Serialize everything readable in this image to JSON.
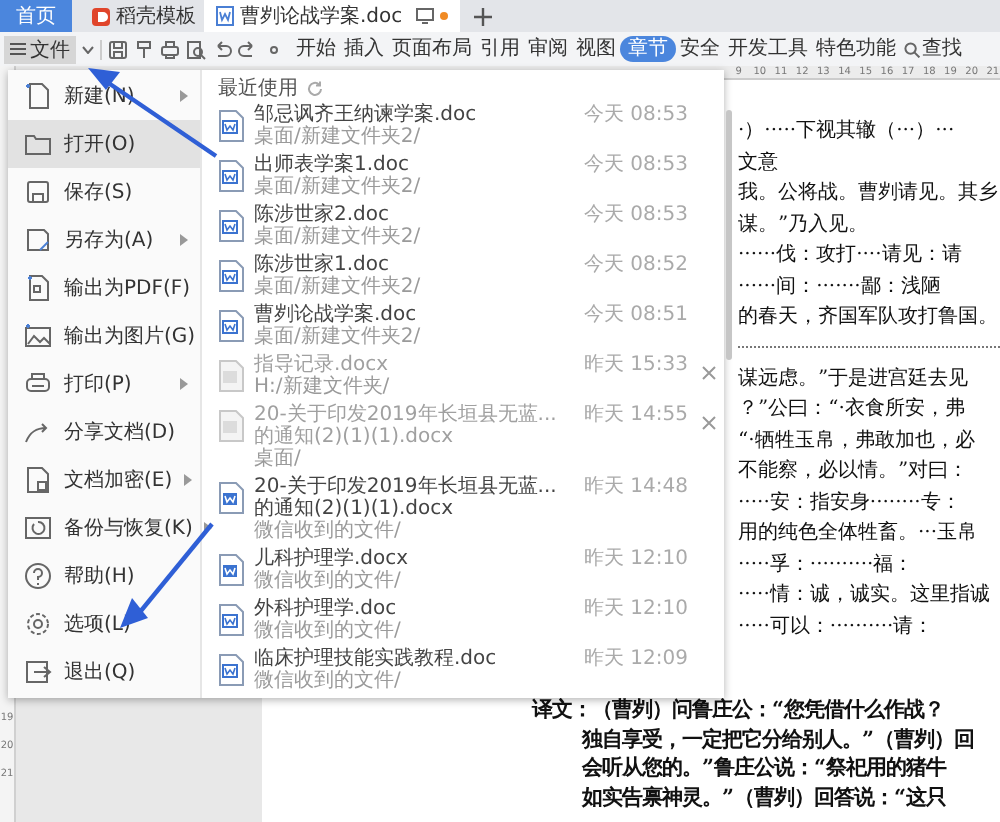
{
  "title_tabs": [
    {
      "kind": "home",
      "label": "首页",
      "selected": false
    },
    {
      "kind": "template",
      "label": "稻壳模板",
      "selected": false
    },
    {
      "kind": "document",
      "label": "曹刿论战学案.doc",
      "selected": true,
      "modified": true
    }
  ],
  "toolbar": {
    "file_menu": {
      "label": "文件",
      "expanded": true
    },
    "ribbon_tabs": [
      {
        "label": "开始",
        "selected": false
      },
      {
        "label": "插入",
        "selected": false
      },
      {
        "label": "页面布局",
        "selected": false
      },
      {
        "label": "引用",
        "selected": false
      },
      {
        "label": "审阅",
        "selected": false
      },
      {
        "label": "视图",
        "selected": false
      },
      {
        "label": "章节",
        "selected": true
      },
      {
        "label": "安全",
        "selected": false
      },
      {
        "label": "开发工具",
        "selected": false
      },
      {
        "label": "特色功能",
        "selected": false
      }
    ],
    "search": {
      "label": "查找"
    }
  },
  "ruler": {
    "marks": [
      "9",
      "10",
      "11",
      "12",
      "13",
      "14",
      "15",
      "16",
      "17",
      "18",
      "19",
      "20",
      "21"
    ]
  },
  "side_ruler": {
    "marks": [
      "19",
      "20",
      "21"
    ]
  },
  "file_menu": {
    "items": [
      {
        "label": "新建(N)",
        "selected": false,
        "submenu": true
      },
      {
        "label": "打开(O)",
        "selected": true,
        "submenu": false
      },
      {
        "label": "保存(S)",
        "selected": false,
        "submenu": false
      },
      {
        "label": "另存为(A)",
        "selected": false,
        "submenu": true
      },
      {
        "label": "输出为PDF(F)",
        "selected": false,
        "submenu": false
      },
      {
        "label": "输出为图片(G)",
        "selected": false,
        "submenu": false
      },
      {
        "label": "打印(P)",
        "selected": false,
        "submenu": true
      },
      {
        "label": "分享文档(D)",
        "selected": false,
        "submenu": false
      },
      {
        "label": "文档加密(E)",
        "selected": false,
        "submenu": true
      },
      {
        "label": "备份与恢复(K)",
        "selected": false,
        "submenu": true
      },
      {
        "label": "帮助(H)",
        "selected": false,
        "submenu": false
      },
      {
        "label": "选项(L)",
        "selected": false,
        "submenu": false
      },
      {
        "label": "退出(Q)",
        "selected": false,
        "submenu": false
      }
    ],
    "recent": {
      "title": "最近使用",
      "files": [
        {
          "kind": "doc",
          "name": "邹忌讽齐王纳谏学案.doc",
          "path": "桌面/新建文件夹2/",
          "time": "今天 08:53",
          "removable": false
        },
        {
          "kind": "doc",
          "name": "出师表学案1.doc",
          "path": "桌面/新建文件夹2/",
          "time": "今天 08:53",
          "removable": false
        },
        {
          "kind": "doc",
          "name": "陈涉世家2.doc",
          "path": "桌面/新建文件夹2/",
          "time": "今天 08:53",
          "removable": false
        },
        {
          "kind": "doc",
          "name": "陈涉世家1.doc",
          "path": "桌面/新建文件夹2/",
          "time": "今天 08:52",
          "removable": false
        },
        {
          "kind": "doc",
          "name": "曹刿论战学案.doc",
          "path": "桌面/新建文件夹2/",
          "time": "今天 08:51",
          "removable": false
        },
        {
          "kind": "missing",
          "name": "指导记录.docx",
          "path": "H:/新建文件夹/",
          "time": "昨天 15:33",
          "removable": true
        },
        {
          "kind": "missing",
          "name": "20-关于印发2019年长垣县无蓝...的通知(2)(1)(1).docx",
          "path": "桌面/",
          "time": "昨天 14:55",
          "removable": true
        },
        {
          "kind": "docx",
          "name": "20-关于印发2019年长垣县无蓝...的通知(2)(1)(1).docx",
          "path": "微信收到的文件/",
          "time": "昨天 14:48",
          "removable": false
        },
        {
          "kind": "docx",
          "name": "儿科护理学.docx",
          "path": "微信收到的文件/",
          "time": "昨天 12:10",
          "removable": false
        },
        {
          "kind": "doc",
          "name": "外科护理学.doc",
          "path": "微信收到的文件/",
          "time": "昨天 12:10",
          "removable": false
        },
        {
          "kind": "doc",
          "name": "临床护理技能实践教程.doc",
          "path": "微信收到的文件/",
          "time": "昨天 12:09",
          "removable": false
        }
      ]
    }
  },
  "document": {
    "upper_lines": [
      {
        "kind": "text",
        "text": "·）·····下视其辙（···）···"
      },
      {
        "kind": "text",
        "text": "文意"
      },
      {
        "kind": "text",
        "text": "我。公将战。曹刿请见。其乡"
      },
      {
        "kind": "text",
        "text": "谋。”乃入见。"
      },
      {
        "kind": "text",
        "text": "······伐：攻打····请见：请"
      },
      {
        "kind": "text",
        "text": "······间：·······鄙：浅陋"
      },
      {
        "kind": "text",
        "text": "的春天，齐国军队攻打鲁国。"
      },
      {
        "kind": "rule"
      },
      {
        "kind": "text",
        "text": "谋远虑。”于是进宫廷去见"
      },
      {
        "kind": "text",
        "text": "？”公曰：“·衣食所安，弗"
      },
      {
        "kind": "text",
        "text": "“·牺牲玉帛，弗敢加也，必"
      },
      {
        "kind": "text",
        "text": "不能察，必以情。”对曰："
      },
      {
        "kind": "text",
        "text": "·····安：指安身········专："
      },
      {
        "kind": "text",
        "text": "用的纯色全体牲畜。···玉帛"
      },
      {
        "kind": "text",
        "text": "·····孚：··········福："
      },
      {
        "kind": "text",
        "text": "·····情：诚，诚实。这里指诚"
      },
      {
        "kind": "text",
        "text": "·····可以：··········请："
      }
    ],
    "translation_lines": [
      "译文：（曹刿）问鲁庄公：“您凭借什么作战？",
      "独自享受，一定把它分给别人。”（曹刿）回",
      "会听从您的。”鲁庄公说：“祭祀用的猪牛",
      "如实告禀神灵。”（曹刿）回答说：“这只"
    ]
  }
}
